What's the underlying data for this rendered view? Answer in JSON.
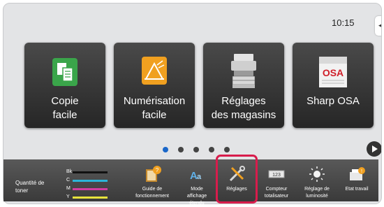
{
  "status": {
    "time": "10:15"
  },
  "tiles": [
    {
      "label_line1": "Copie",
      "label_line2": "facile",
      "icon": "copy-icon"
    },
    {
      "label_line1": "Numérisation",
      "label_line2": "facile",
      "icon": "scan-icon"
    },
    {
      "label_line1": "Réglages",
      "label_line2": "des magasins",
      "icon": "printer-tray-icon"
    },
    {
      "label_line1": "Sharp OSA",
      "label_line2": "",
      "icon": "osa-icon"
    }
  ],
  "pagination": {
    "pages": 5,
    "current": 1
  },
  "toner": {
    "label_line1": "Quantité de",
    "label_line2": "toner",
    "rows": [
      {
        "name": "Bk",
        "color": "#111111"
      },
      {
        "name": "C",
        "color": "#2bb5d8"
      },
      {
        "name": "M",
        "color": "#d23da0"
      },
      {
        "name": "Y",
        "color": "#e7e33c"
      }
    ]
  },
  "bottom_bar": [
    {
      "label_line1": "Guide de",
      "label_line2": "fonctionnement",
      "label_line3": "",
      "icon": "guide-icon"
    },
    {
      "label_line1": "Mode",
      "label_line2": "affichage",
      "label_line3": "étendu",
      "icon": "display-mode-icon"
    },
    {
      "label_line1": "Réglages",
      "label_line2": "",
      "label_line3": "",
      "icon": "settings-tools-icon"
    },
    {
      "label_line1": "Compteur",
      "label_line2": "totalisateur",
      "label_line3": "",
      "icon": "counter-icon"
    },
    {
      "label_line1": "Réglage de",
      "label_line2": "luminosité",
      "label_line3": "",
      "icon": "brightness-icon"
    },
    {
      "label_line1": "Etat travail",
      "label_line2": "",
      "label_line3": "",
      "icon": "job-status-icon"
    }
  ],
  "colors": {
    "highlight": "#d81c4c",
    "accent_dot": "#1a67c9",
    "copy_green": "#3aa54a",
    "scan_orange": "#f0a020"
  }
}
